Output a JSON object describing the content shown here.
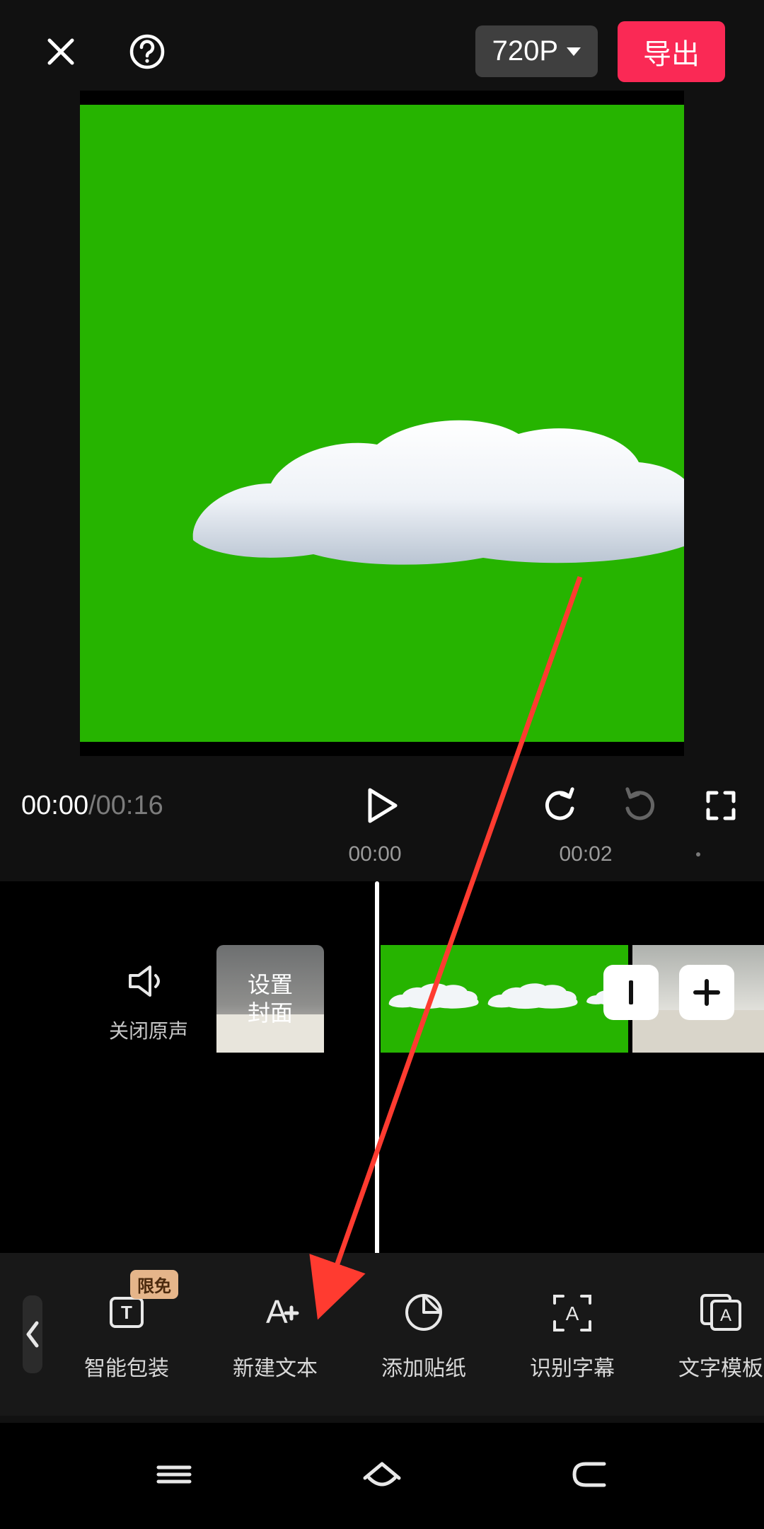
{
  "header": {
    "resolution_label": "720P",
    "export_label": "导出"
  },
  "playback": {
    "current_time": "00:00",
    "separator": " / ",
    "total_time": "00:16"
  },
  "ruler": {
    "marks": [
      "00:00",
      "00:02"
    ]
  },
  "timeline": {
    "mute_label": "关闭原声",
    "cover_line1": "设置",
    "cover_line2": "封面"
  },
  "toolbar": {
    "items": [
      {
        "label": "智能包装",
        "badge": "限免"
      },
      {
        "label": "新建文本",
        "badge": null
      },
      {
        "label": "添加贴纸",
        "badge": null
      },
      {
        "label": "识别字幕",
        "badge": null
      },
      {
        "label": "文字模板",
        "badge": null
      }
    ]
  }
}
